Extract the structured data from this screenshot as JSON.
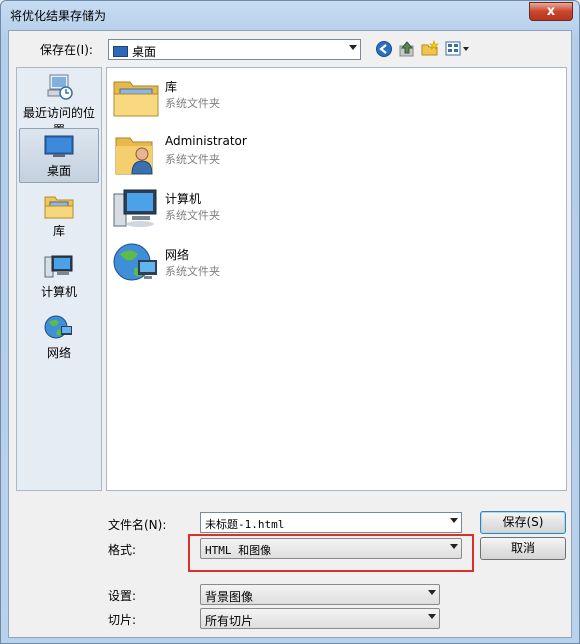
{
  "window": {
    "title": "将优化结果存储为",
    "close": "x"
  },
  "toolbar": {
    "savein_label": "保存在(I):",
    "savein_value": "桌面"
  },
  "places": [
    {
      "label": "最近访问的位置",
      "icon": "recent-places-icon"
    },
    {
      "label": "桌面",
      "icon": "desktop-icon",
      "selected": true
    },
    {
      "label": "库",
      "icon": "library-icon"
    },
    {
      "label": "计算机",
      "icon": "computer-icon"
    },
    {
      "label": "网络",
      "icon": "network-icon"
    }
  ],
  "files": [
    {
      "name": "库",
      "desc": "系统文件夹",
      "icon": "library-folder-icon"
    },
    {
      "name": "Administrator",
      "desc": "系统文件夹",
      "icon": "user-folder-icon"
    },
    {
      "name": "计算机",
      "desc": "系统文件夹",
      "icon": "computer-icon"
    },
    {
      "name": "网络",
      "desc": "系统文件夹",
      "icon": "network-icon"
    }
  ],
  "form": {
    "filename_label": "文件名(N):",
    "filename_value": "未标题-1.html",
    "format_label": "格式:",
    "format_value": "HTML 和图像",
    "settings_label": "设置:",
    "settings_value": "背景图像",
    "slices_label": "切片:",
    "slices_value": "所有切片"
  },
  "buttons": {
    "save": "保存(S)",
    "cancel": "取消"
  },
  "colors": {
    "highlight_box": "#d9302a",
    "selection": "#c3d0de"
  }
}
